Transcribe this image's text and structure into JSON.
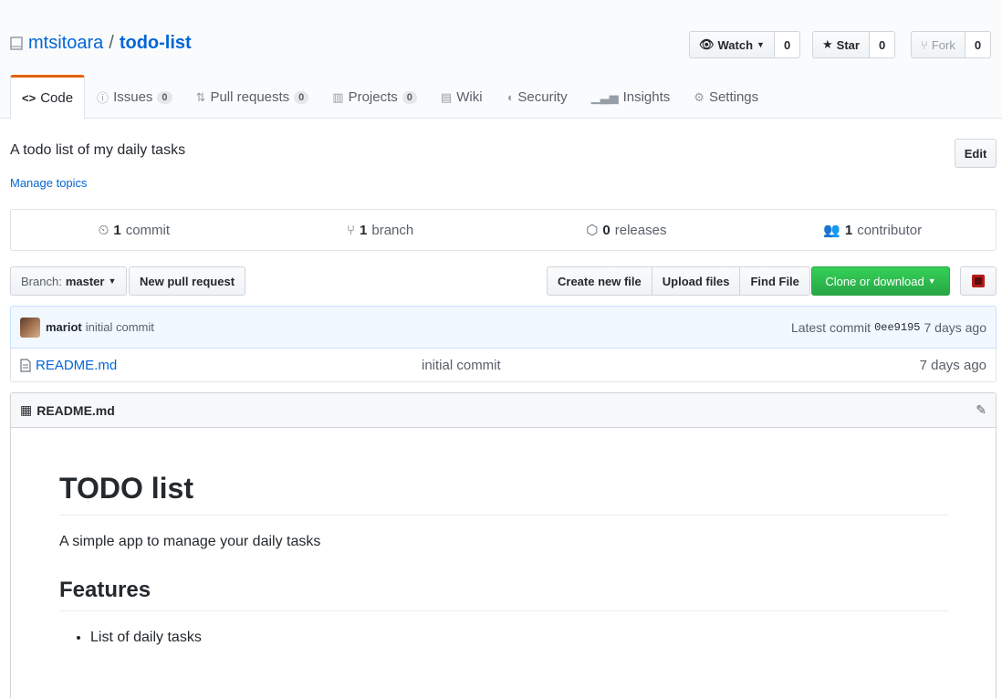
{
  "repo": {
    "owner": "mtsitoara",
    "separator": "/",
    "name": "todo-list"
  },
  "social": {
    "watch_label": "Watch",
    "watch_count": "0",
    "star_label": "Star",
    "star_count": "0",
    "fork_label": "Fork",
    "fork_count": "0"
  },
  "tabs": [
    {
      "label": "Code",
      "icon": "code-icon"
    },
    {
      "label": "Issues",
      "count": "0",
      "icon": "issue-icon"
    },
    {
      "label": "Pull requests",
      "count": "0",
      "icon": "pull-request-icon"
    },
    {
      "label": "Projects",
      "count": "0",
      "icon": "project-icon"
    },
    {
      "label": "Wiki",
      "icon": "book-icon"
    },
    {
      "label": "Security",
      "icon": "shield-icon"
    },
    {
      "label": "Insights",
      "icon": "graph-icon"
    },
    {
      "label": "Settings",
      "icon": "gear-icon"
    }
  ],
  "description": "A todo list of my daily tasks",
  "manage_topics": "Manage topics",
  "edit_label": "Edit",
  "summary": {
    "commits_num": "1",
    "commits_label": "commit",
    "branches_num": "1",
    "branches_label": "branch",
    "releases_num": "0",
    "releases_label": "releases",
    "contributors_num": "1",
    "contributors_label": "contributor"
  },
  "file_nav": {
    "branch_prefix": "Branch:",
    "branch_name": "master",
    "new_pr": "New pull request",
    "create_file": "Create new file",
    "upload_files": "Upload files",
    "find_file": "Find File",
    "clone": "Clone or download"
  },
  "latest_commit": {
    "author": "mariot",
    "message": "initial commit",
    "prefix": "Latest commit",
    "sha": "0ee9195",
    "age": "7 days ago"
  },
  "files": [
    {
      "name": "README.md",
      "message": "initial commit",
      "age": "7 days ago"
    }
  ],
  "readme": {
    "filename": "README.md",
    "h1": "TODO list",
    "intro": "A simple app to manage your daily tasks",
    "h2": "Features",
    "items": [
      "List of daily tasks"
    ]
  },
  "colors": {
    "accent": "#0366d6",
    "tab_active": "#e36209",
    "clone_green": "#28a745"
  }
}
